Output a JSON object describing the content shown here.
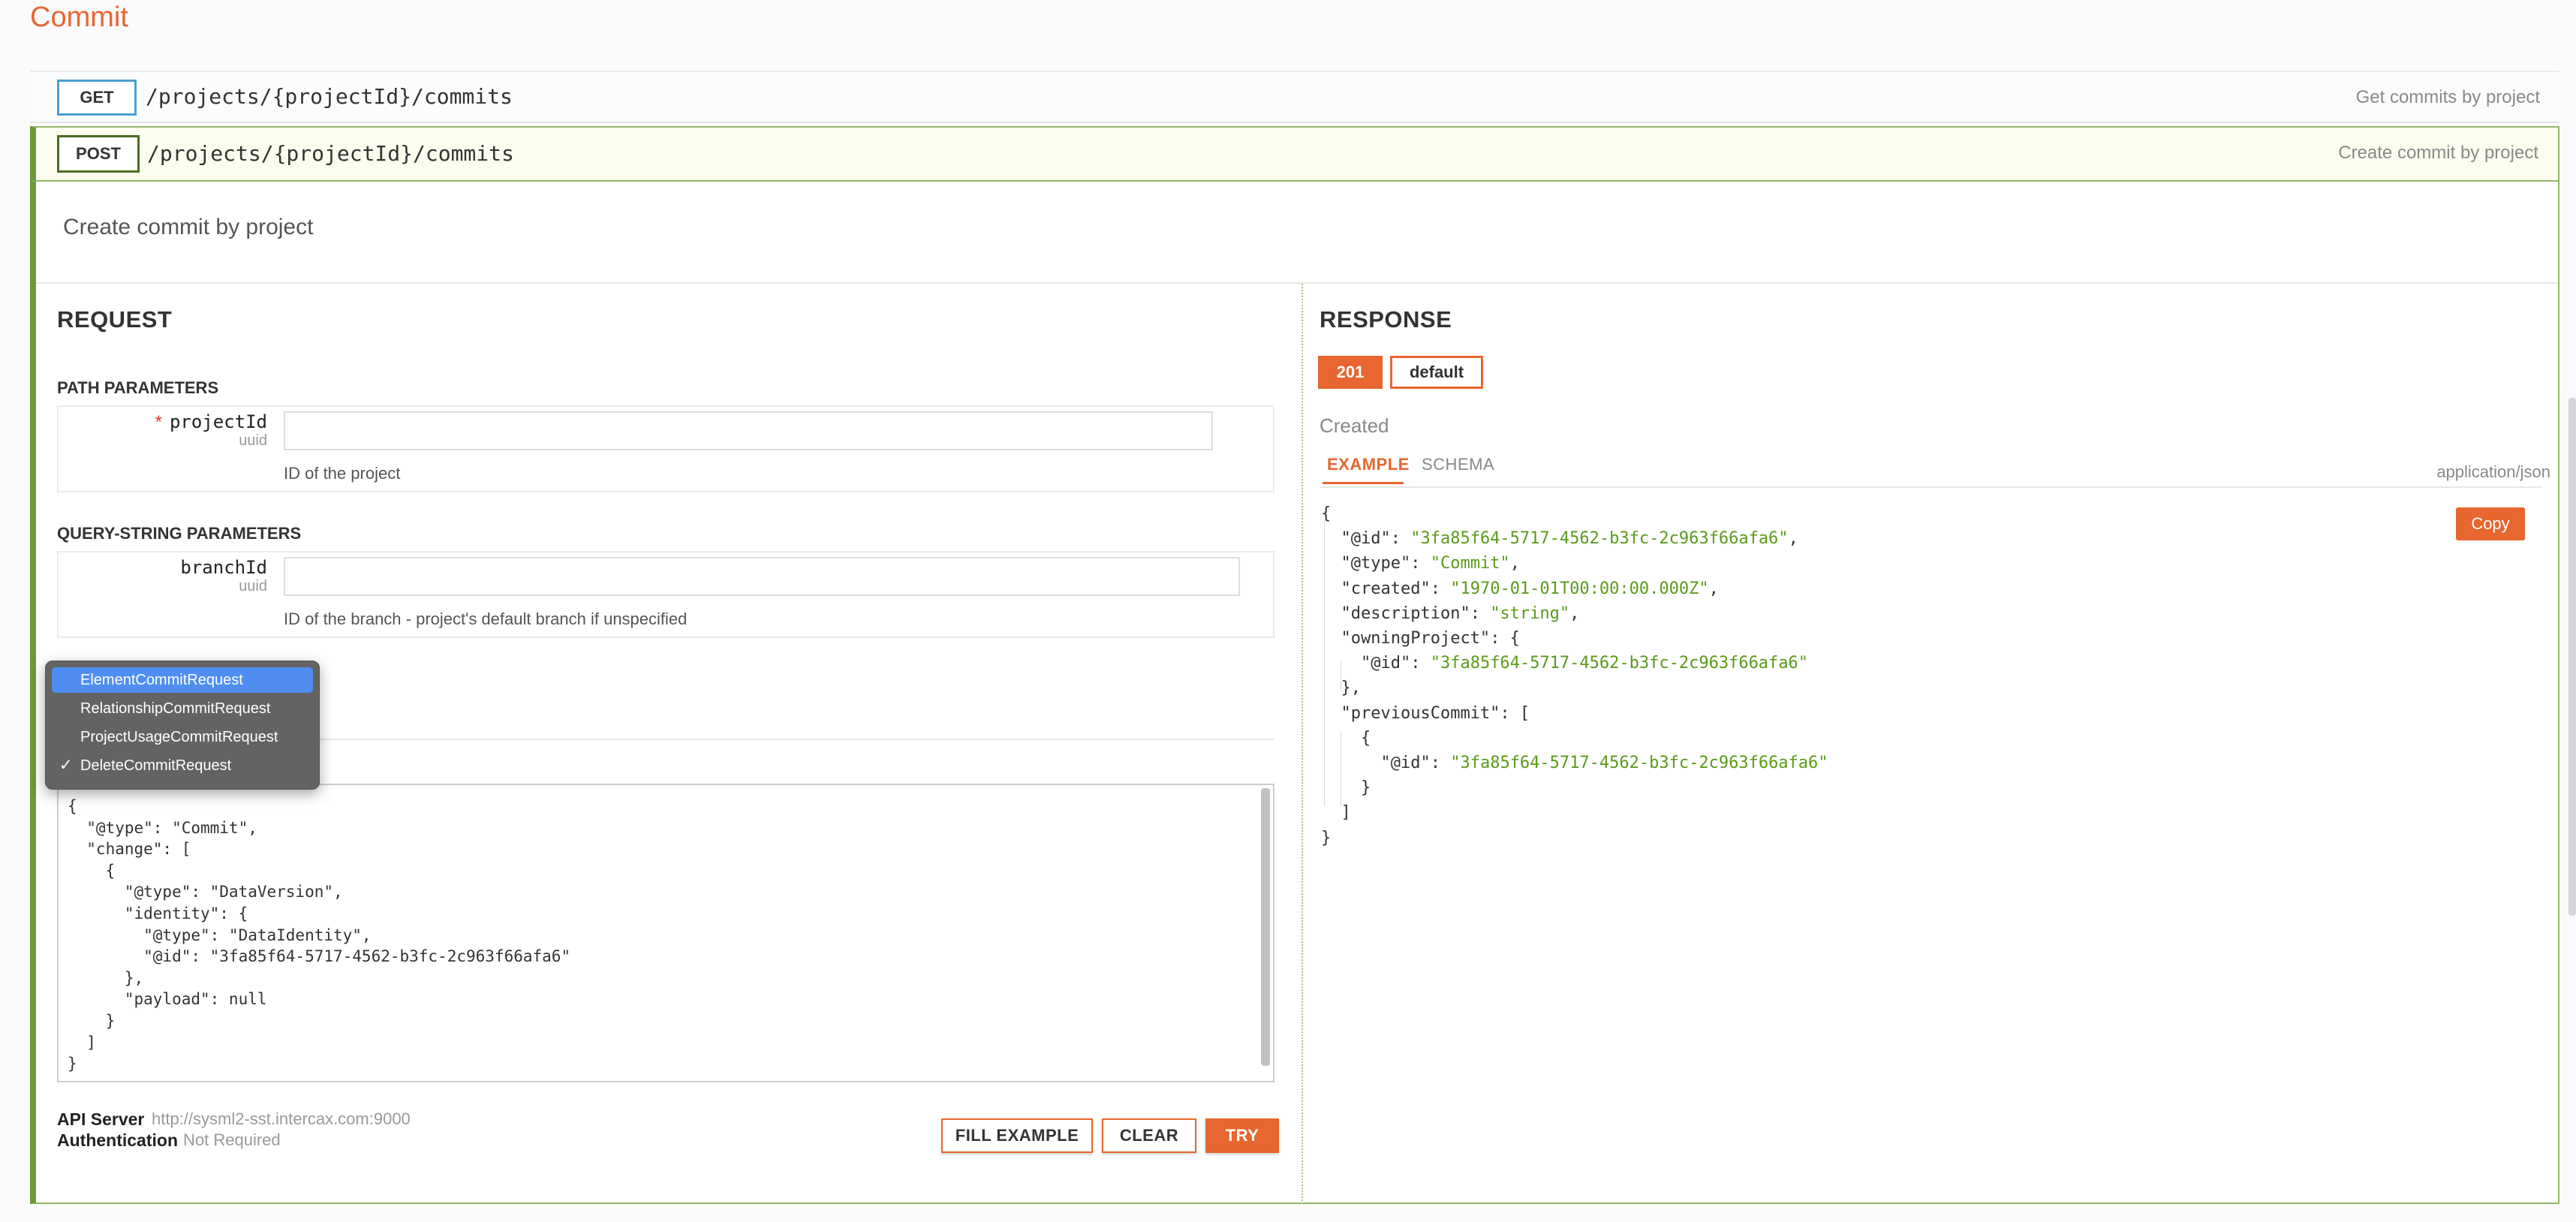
{
  "section": {
    "title": "Commit"
  },
  "operations": {
    "get": {
      "method": "GET",
      "path": "/projects/{projectId}/commits",
      "summary": "Get commits by project"
    },
    "post": {
      "method": "POST",
      "path": "/projects/{projectId}/commits",
      "summary": "Create commit by project",
      "description": "Create commit by project"
    }
  },
  "request": {
    "heading": "REQUEST",
    "path_parameters": {
      "heading": "PATH PARAMETERS",
      "projectId": {
        "required_mark": "*",
        "name": "projectId",
        "type": "uuid",
        "value": "",
        "description": "ID of the project"
      }
    },
    "query_parameters": {
      "heading": "QUERY-STRING PARAMETERS",
      "branchId": {
        "name": "branchId",
        "type": "uuid",
        "value": "",
        "description": "ID of the branch - project's default branch if unspecified"
      }
    },
    "body_dropdown": {
      "options": [
        "ElementCommitRequest",
        "RelationshipCommitRequest",
        "ProjectUsageCommitRequest",
        "DeleteCommitRequest"
      ],
      "highlighted": "ElementCommitRequest",
      "checked": "DeleteCommitRequest",
      "check_mark": "✓"
    },
    "body_text": "{\n  \"@type\": \"Commit\",\n  \"change\": [\n    {\n      \"@type\": \"DataVersion\",\n      \"identity\": {\n        \"@type\": \"DataIdentity\",\n        \"@id\": \"3fa85f64-5717-4562-b3fc-2c963f66afa6\"\n      },\n      \"payload\": null\n    }\n  ]\n}",
    "api_server": {
      "label": "API Server",
      "value": "http://sysml2-sst.intercax.com:9000"
    },
    "authentication": {
      "label": "Authentication",
      "value": "Not Required"
    },
    "buttons": {
      "fill_example": "FILL EXAMPLE",
      "clear": "CLEAR",
      "try": "TRY"
    }
  },
  "response": {
    "heading": "RESPONSE",
    "status_codes": [
      "201",
      "default"
    ],
    "status_description": "Created",
    "tabs": [
      "EXAMPLE",
      "SCHEMA"
    ],
    "content_type": "application/json",
    "copy_label": "Copy",
    "example": {
      "id_key": "\"@id\"",
      "id_value": "\"3fa85f64-5717-4562-b3fc-2c963f66afa6\"",
      "type_key": "\"@type\"",
      "type_value": "\"Commit\"",
      "created_key": "\"created\"",
      "created_value": "\"1970-01-01T00:00:00.000Z\"",
      "description_key": "\"description\"",
      "description_value": "\"string\"",
      "owning_key": "\"owningProject\"",
      "owning_id_value": "\"3fa85f64-5717-4562-b3fc-2c963f66afa6\"",
      "previous_key": "\"previousCommit\"",
      "previous_id_value": "\"3fa85f64-5717-4562-b3fc-2c963f66afa6\""
    }
  },
  "colors": {
    "accent": "#e8662f",
    "post_green": "#6b9a3a",
    "get_blue": "#4b9ed6",
    "string_green": "#5a9a1a",
    "dropdown_highlight": "#4f8ef0"
  }
}
